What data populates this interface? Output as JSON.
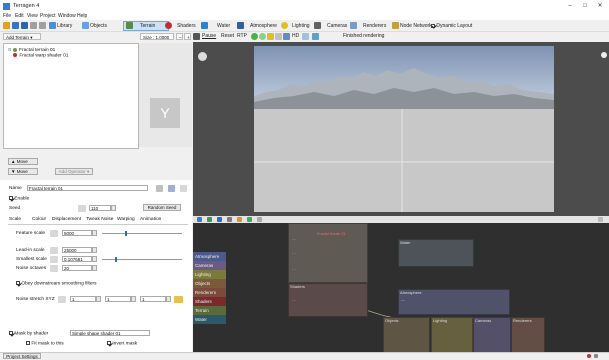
{
  "window": {
    "title": "Terragen 4",
    "minimize": "–",
    "maximize": "□",
    "close": "✕"
  },
  "menu": [
    "File",
    "Edit",
    "View",
    "Project",
    "Window",
    "Help"
  ],
  "toolbar": {
    "library": "Library",
    "objects": "Objects",
    "terrain": "Terrain",
    "shaders": "Shaders",
    "water": "Water",
    "atmosphere": "Atmosphere",
    "lighting": "Lighting",
    "cameras": "Cameras",
    "renderers": "Renderers",
    "node_network": "Node Network",
    "dynamic_layout": "Dynamic Layout"
  },
  "toolbar2": {
    "add_terrain": "Add Terrain",
    "size": "Size : 1.0000",
    "pause": "Pause",
    "reset": "Reset",
    "rtp": "RTP",
    "hd": "HD",
    "finished": "Finished rendering"
  },
  "tree": {
    "items": [
      "Fractal terrain 01",
      "Fractal warp shader 01"
    ]
  },
  "left": {
    "move_up": "▲ Move",
    "move_down": "▼ Move",
    "add_operator": "Add Operator"
  },
  "props": {
    "name_label": "Name",
    "name_value": "Fractal terrain 01",
    "enable_label": "Enable",
    "seed_label": "Seed",
    "seed_value": "110",
    "random_seed": "Random Seed",
    "tabs": [
      "Scale",
      "Colour",
      "Displacement",
      "Tweak Noise",
      "Warping",
      "Animation"
    ],
    "feature_scale_label": "Feature scale",
    "feature_scale_value": "5000",
    "lead_in_scale_label": "Lead-in scale",
    "lead_in_scale_value": "25000",
    "smallest_scale_label": "Smallest scale",
    "smallest_scale_value": "0.107681",
    "noise_octaves_label": "Noise octaves",
    "noise_octaves_value": "20",
    "obey_label": "Obey downstream smoothing filters",
    "noise_stretch_label": "Noise stretch XYZ",
    "stretch_x": "1",
    "stretch_y": "1",
    "stretch_z": "1",
    "mask_label": "Mask by shader",
    "mask_value": "Simple shape shader 01",
    "fit_mask_label": "Fit mask to this",
    "invert_mask_label": "Invert mask"
  },
  "node_categories": [
    {
      "label": "Atmosphere",
      "color": "#4b5a8a"
    },
    {
      "label": "Cameras",
      "color": "#6a5a86"
    },
    {
      "label": "Lighting",
      "color": "#7a7a3a"
    },
    {
      "label": "Objects",
      "color": "#7a5a3a"
    },
    {
      "label": "Renderers",
      "color": "#7a4a3a"
    },
    {
      "label": "Shaders",
      "color": "#7a2a2a"
    },
    {
      "label": "Terrain",
      "color": "#5a6a3a"
    },
    {
      "label": "Water",
      "color": "#2a5a6a"
    }
  ],
  "node_groups": {
    "shaders": "Shaders",
    "water": "Water",
    "atmosphere": "Atmosphere",
    "objects": "Objects",
    "lighting": "Lighting",
    "cameras": "Cameras",
    "renderers": "Renderers"
  },
  "statusbar": {
    "left": "Project Settings"
  }
}
